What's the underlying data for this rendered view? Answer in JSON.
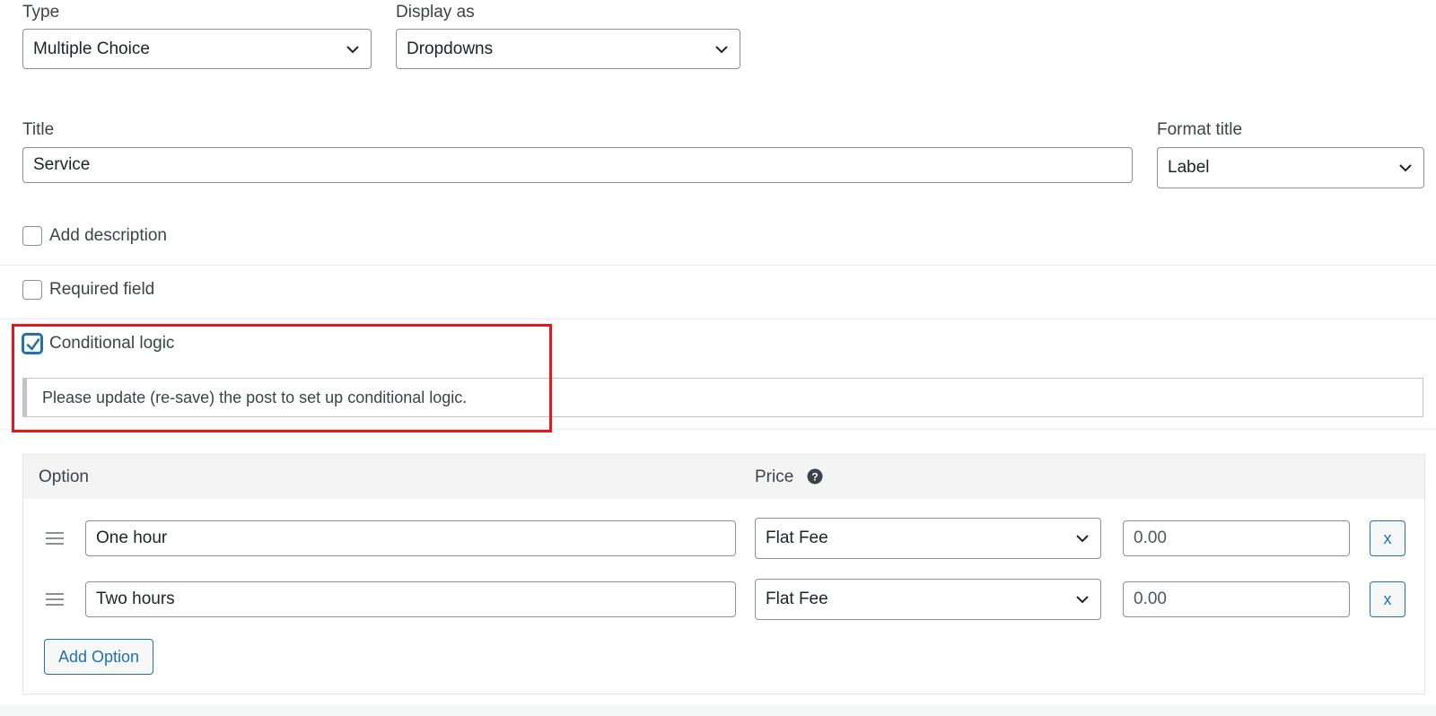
{
  "type_field": {
    "label": "Type",
    "value": "Multiple Choice"
  },
  "display_field": {
    "label": "Display as",
    "value": "Dropdowns"
  },
  "title_field": {
    "label": "Title",
    "value": "Service"
  },
  "format_title_field": {
    "label": "Format title",
    "value": "Label"
  },
  "checkboxes": {
    "add_description": {
      "label": "Add description",
      "checked": false
    },
    "required_field": {
      "label": "Required field",
      "checked": false
    },
    "conditional_logic": {
      "label": "Conditional logic",
      "checked": true
    }
  },
  "notice": {
    "text": "Please update (re-save) the post to set up conditional logic."
  },
  "options_table": {
    "header": {
      "option": "Option",
      "price": "Price"
    },
    "rows": [
      {
        "option": "One hour",
        "price_type": "Flat Fee",
        "price": "0.00",
        "remove": "x"
      },
      {
        "option": "Two hours",
        "price_type": "Flat Fee",
        "price": "0.00",
        "remove": "x"
      }
    ],
    "add_button": "Add Option"
  },
  "colors": {
    "accent": "#2271b1",
    "highlight_box": "#e8141e",
    "border": "#8c8f94"
  },
  "icons": [
    "chevron-down-icon",
    "checkmark-icon",
    "help-icon",
    "drag-handle-icon"
  ]
}
